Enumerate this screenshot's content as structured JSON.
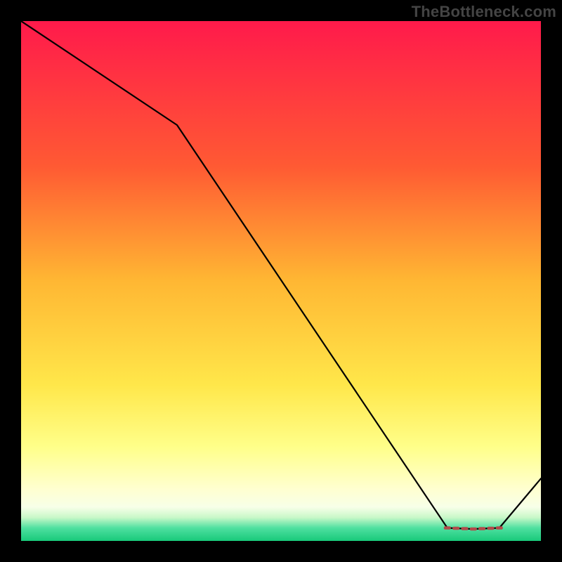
{
  "watermark": "TheBottleneck.com",
  "chart_data": {
    "type": "line",
    "title": "",
    "xlabel": "",
    "ylabel": "",
    "xlim": [
      0,
      100
    ],
    "ylim": [
      0,
      100
    ],
    "series": [
      {
        "name": "curve",
        "x": [
          0,
          30,
          82,
          87,
          92,
          100
        ],
        "values": [
          100,
          80,
          2.5,
          2.3,
          2.5,
          12
        ]
      }
    ],
    "flat_region": {
      "x_start": 82,
      "x_end": 92,
      "marker_color": "#b24b4b"
    },
    "gradient_stops": [
      {
        "offset": 0.0,
        "color": "#ff1a4b"
      },
      {
        "offset": 0.28,
        "color": "#ff5a33"
      },
      {
        "offset": 0.5,
        "color": "#ffb733"
      },
      {
        "offset": 0.7,
        "color": "#ffe74a"
      },
      {
        "offset": 0.82,
        "color": "#ffff8a"
      },
      {
        "offset": 0.9,
        "color": "#ffffd0"
      },
      {
        "offset": 0.935,
        "color": "#f7ffe8"
      },
      {
        "offset": 0.955,
        "color": "#c8f8c8"
      },
      {
        "offset": 0.975,
        "color": "#4fe0a0"
      },
      {
        "offset": 1.0,
        "color": "#18c97a"
      }
    ]
  }
}
